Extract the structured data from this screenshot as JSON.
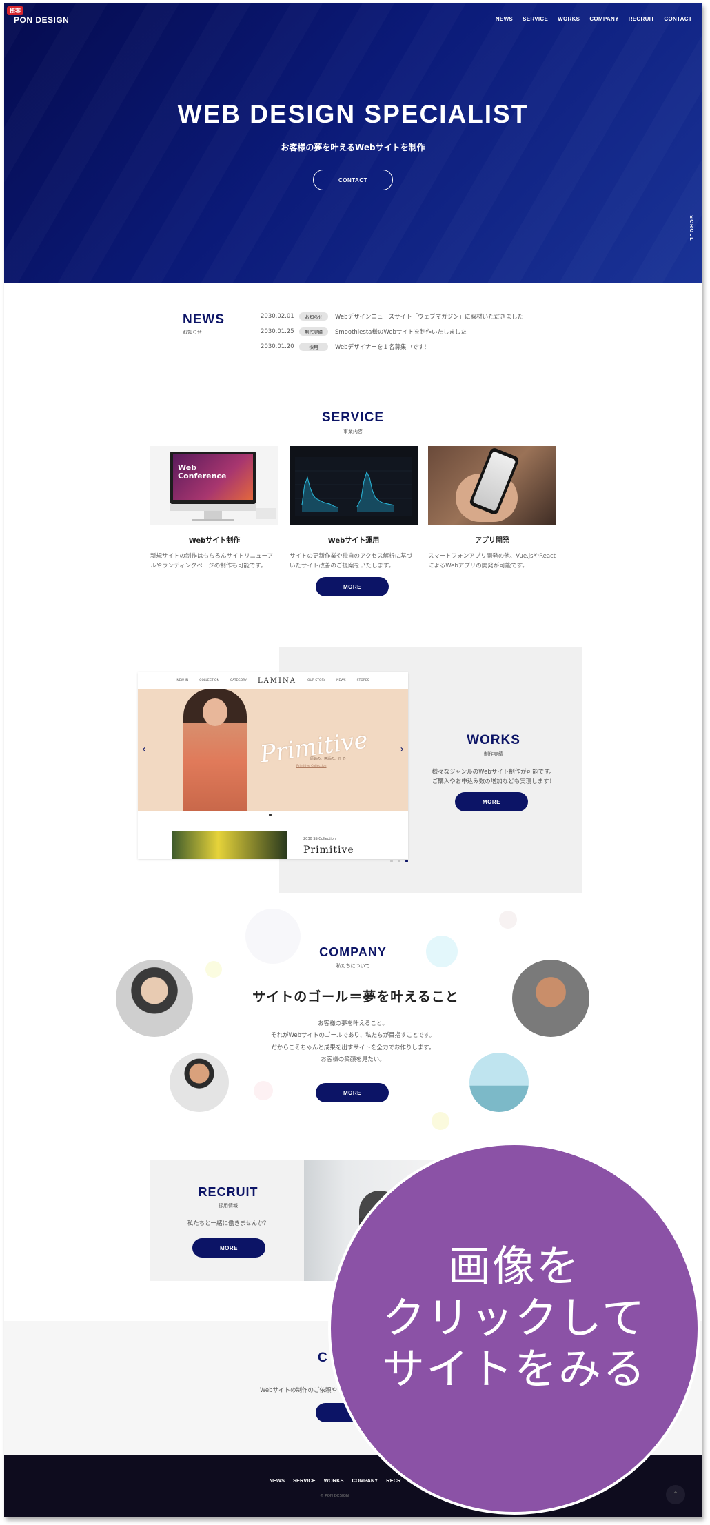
{
  "badge": "接客",
  "site": {
    "logo": "PON DESIGN"
  },
  "nav": [
    "NEWS",
    "SERVICE",
    "WORKS",
    "COMPANY",
    "RECRUIT",
    "CONTACT"
  ],
  "hero": {
    "title": "WEB DESIGN SPECIALIST",
    "subtitle": "お客様の夢を叶えるWebサイトを制作",
    "button": "CONTACT",
    "scroll": "SCROLL"
  },
  "news": {
    "title": "NEWS",
    "subtitle": "お知らせ",
    "items": [
      {
        "date": "2030.02.01",
        "category": "お知らせ",
        "text": "Webデザインニュースサイト「ウェブマガジン」に取材いただきました"
      },
      {
        "date": "2030.01.25",
        "category": "制作実績",
        "text": "Smoothiesta様のWebサイトを制作いたしました"
      },
      {
        "date": "2030.01.20",
        "category": "採用",
        "text": "Webデザイナーを１名募集中です！"
      }
    ]
  },
  "service": {
    "title": "SERVICE",
    "subtitle": "事業内容",
    "items": [
      {
        "name": "Webサイト制作",
        "desc": "新規サイトの制作はもちろんサイトリニューアルやランディングページの制作も可能です。",
        "thumb_title": "Web Conference"
      },
      {
        "name": "Webサイト運用",
        "desc": "サイトの更新作業や独自のアクセス解析に基づいたサイト改善のご提案をいたします。"
      },
      {
        "name": "アプリ開発",
        "desc": "スマートフォンアプリ開発の他、Vue.jsやReactによるWebアプリの開発が可能です。"
      }
    ],
    "button": "MORE"
  },
  "works": {
    "title": "WORKS",
    "subtitle": "制作実績",
    "desc_lines": [
      "様々なジャンルのWebサイト制作が可能です。",
      "ご購入やお申込み数の増加なども実現します！"
    ],
    "button": "MORE",
    "mock": {
      "nav_left": [
        "NEW IN",
        "COLLECTION",
        "CATEGORY"
      ],
      "brand": "LAMINA",
      "nav_right": [
        "OUR STORY",
        "NEWS",
        "STORES"
      ],
      "hero_script": "Primitive",
      "hero_tag": "原始の、無垢の、元 の",
      "hero_link": "Primitive Collection",
      "sub_label": "2030 SS Collection",
      "sub_title": "Primitive"
    }
  },
  "company": {
    "title": "COMPANY",
    "subtitle": "私たちについて",
    "headline": "サイトのゴール＝夢を叶えること",
    "desc_lines": [
      "お客様の夢を叶えること。",
      "それがWebサイトのゴールであり、私たちが目指すことです。",
      "だからこそちゃんと成果を出すサイトを全力でお作りします。",
      "お客様の笑顔を見たい。"
    ],
    "button": "MORE"
  },
  "recruit": {
    "title": "RECRUIT",
    "subtitle": "採用情報",
    "desc": "私たちと一緒に働きませんか？",
    "button": "MORE"
  },
  "contact": {
    "title_partial": "C",
    "desc_partial": "Webサイトの制作のご依頼や"
  },
  "footer": {
    "nav": [
      "NEWS",
      "SERVICE",
      "WORKS",
      "COMPANY",
      "RECR"
    ],
    "copyright": "© PON DESIGN",
    "totop": "⌃"
  },
  "overlay": {
    "lines": [
      "画像を",
      "クリックして",
      "サイトをみる"
    ]
  },
  "colors": {
    "navy": "#0c1466",
    "overlay": "#8b52a6",
    "highlight": "#f5f03a",
    "footer": "#0e0c1e"
  }
}
